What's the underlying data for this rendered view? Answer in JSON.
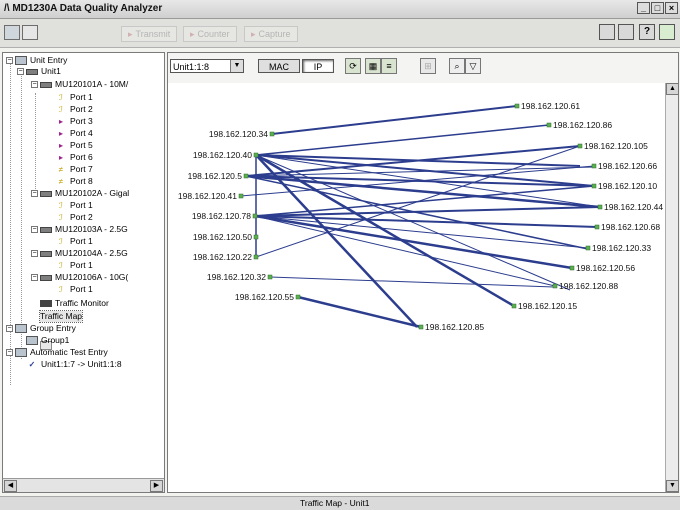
{
  "window": {
    "title": "MD1230A Data Quality Analyzer",
    "controls": [
      "_",
      "□",
      "×"
    ]
  },
  "toolbar": {
    "buttons": [
      {
        "label": "Transmit",
        "icon": "transmit-icon"
      },
      {
        "label": "Counter",
        "icon": "counter-icon"
      },
      {
        "label": "Capture",
        "icon": "capture-icon"
      }
    ]
  },
  "tree": {
    "items": [
      {
        "label": "Unit Entry",
        "icon": "unit-entry-icon"
      },
      {
        "label": "Unit1",
        "icon": "unit-icon"
      },
      {
        "label": "MU120101A - 10M/",
        "icon": "module-icon"
      },
      {
        "label": "Port 1",
        "icon": "port-icon"
      },
      {
        "label": "Port 2",
        "icon": "port-icon"
      },
      {
        "label": "Port 3",
        "icon": "port-icon"
      },
      {
        "label": "Port 4",
        "icon": "port-icon"
      },
      {
        "label": "Port 5",
        "icon": "port-icon"
      },
      {
        "label": "Port 6",
        "icon": "port-icon"
      },
      {
        "label": "Port 7",
        "icon": "port-icon"
      },
      {
        "label": "Port 8",
        "icon": "port-icon"
      },
      {
        "label": "MU120102A - Gigal",
        "icon": "module-icon"
      },
      {
        "label": "Port 1",
        "icon": "port-icon"
      },
      {
        "label": "Port 2",
        "icon": "port-icon"
      },
      {
        "label": "MU120103A - 2.5G",
        "icon": "module-icon"
      },
      {
        "label": "Port 1",
        "icon": "port-icon"
      },
      {
        "label": "MU120104A - 2.5G",
        "icon": "module-icon"
      },
      {
        "label": "Port 1",
        "icon": "port-icon"
      },
      {
        "label": "MU120106A - 10G(",
        "icon": "module-icon"
      },
      {
        "label": "Port 1",
        "icon": "port-icon"
      },
      {
        "label": "Traffic Monitor",
        "icon": "monitor-icon"
      },
      {
        "label": "Traffic Map",
        "icon": "map-icon"
      },
      {
        "label": "Group Entry",
        "icon": "group-entry-icon"
      },
      {
        "label": "Group1",
        "icon": "group-icon"
      },
      {
        "label": "Automatic Test Entry",
        "icon": "auto-test-icon"
      },
      {
        "label": "Unit1:1:7 -> Unit1:1:8",
        "icon": "check-icon"
      }
    ]
  },
  "panel": {
    "unit_select": "Unit1:1:8",
    "mode_buttons": {
      "mac": "MAC",
      "ip": "IP"
    },
    "active_mode": "IP"
  },
  "traffic_map": {
    "left_nodes": [
      "198.162.120.34",
      "198.162.120.40",
      "198.162.120.5",
      "198.162.120.41",
      "198.162.120.78",
      "198.162.120.50",
      "198.162.120.22",
      "198.162.120.32",
      "198.162.120.55"
    ],
    "right_nodes": [
      "198.162.120.61",
      "198.162.120.86",
      "198.162.120.105",
      "198.162.120.66",
      "198.162.120.10",
      "198.162.120.44",
      "198.162.120.68",
      "198.162.120.33",
      "198.162.120.56",
      "198.162.120.88",
      "198.162.120.15",
      "198.162.120.85"
    ]
  },
  "status": {
    "text": "Traffic Map - Unit1"
  }
}
